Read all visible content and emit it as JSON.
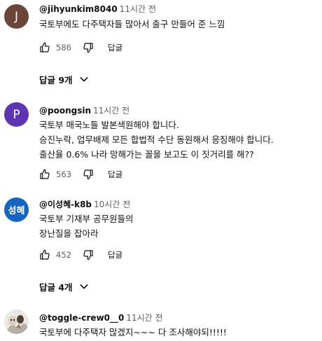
{
  "comments": [
    {
      "avatar_letter": "J",
      "avatar_color": "#6b4538",
      "handle": "@jihyunkim8040",
      "time": "11시간 전",
      "lines": [
        "국토부에도 다주택자들 많아서 출구 만들어 준 느낌"
      ],
      "likes": "586",
      "reply_label": "답글",
      "replies_label": "답글 9개"
    },
    {
      "avatar_letter": "P",
      "avatar_color": "#5e35b1",
      "handle": "@poongsin",
      "time": "11시간 전",
      "lines": [
        "국토부 매국노들 발본색원해야 합니다.",
        "승진누락, 업무배제 모든 합법적 수단 동원해서 응징해야 합니다.",
        "출산율 0.6% 나라 망해가는 꼴을 보고도 이 짓거리를 해??"
      ],
      "likes": "563",
      "reply_label": "답글"
    },
    {
      "avatar_letter": "성혜",
      "avatar_color": "#1565c0",
      "handle": "@이성혜-k8b",
      "time": "10시간 전",
      "lines": [
        "국토부 기재부 공무원들의",
        "장난질을 잡아라"
      ],
      "likes": "452",
      "reply_label": "답글",
      "replies_label": "답글 4개"
    },
    {
      "avatar_color": "#e8e4de",
      "handle": "@toggle-crew0__0",
      "time": "11시간 전",
      "lines": [
        "국토부에 다주택자 많겠지~~~ 다 조사해야되!!!!!"
      ]
    }
  ],
  "icons": {
    "like": "thumb-up-icon",
    "dislike": "thumb-down-icon",
    "expand": "chevron-down-icon"
  }
}
